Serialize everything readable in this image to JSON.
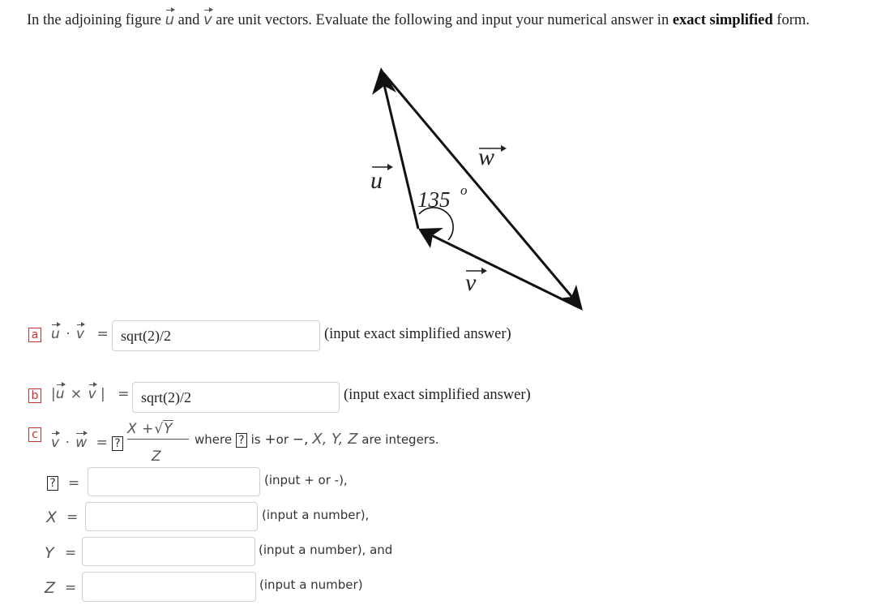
{
  "intro": {
    "prefix": "In the adjoining figure",
    "vec_u": "u",
    "and": "and",
    "vec_v": "v",
    "middle": "are unit vectors. Evaluate the following and input your numerical answer in",
    "bold": "exact simplified",
    "suffix": "form."
  },
  "figure": {
    "label_u": "u",
    "label_v": "v",
    "label_w": "w",
    "angle_label": "135",
    "angle_unit": "o"
  },
  "parts": {
    "a": {
      "label": "a",
      "vec1": "u",
      "op": "·",
      "vec2": "v",
      "equals": "=",
      "value": "sqrt(2)/2",
      "hint": "(input exact simplified answer)"
    },
    "b": {
      "label": "b",
      "bar_left": "|",
      "vec1": "u",
      "op": "×",
      "vec2": "v",
      "bar_right": "|",
      "equals": "=",
      "value": "sqrt(2)/2",
      "hint": "(input exact simplified answer)"
    },
    "c": {
      "label": "c",
      "vec1": "v",
      "op": "·",
      "vec2": "w",
      "equals": "=",
      "sign_box": "?",
      "numerator_x": "X",
      "numerator_plus": "+",
      "numerator_y": "Y",
      "denominator": "Z",
      "where": "where",
      "where_box": "?",
      "is_text": "is",
      "plus_sym": "+",
      "or_text": "or",
      "minus_sym": "−,",
      "vars": "X, Y, Z",
      "are_integers": "are integers."
    }
  },
  "inputs": [
    {
      "label": "?",
      "boxed": true,
      "equals": "=",
      "value": "",
      "hint": "(input + or -),"
    },
    {
      "label": "X",
      "boxed": false,
      "equals": "=",
      "value": "",
      "hint": "(input a number),"
    },
    {
      "label": "Y",
      "boxed": false,
      "equals": "=",
      "value": "",
      "hint": "(input a number), and"
    },
    {
      "label": "Z",
      "boxed": false,
      "equals": "=",
      "value": "",
      "hint": "(input a number)"
    }
  ],
  "colors": {
    "part_label": "#c9302c",
    "input_border": "#cfcfcf"
  }
}
